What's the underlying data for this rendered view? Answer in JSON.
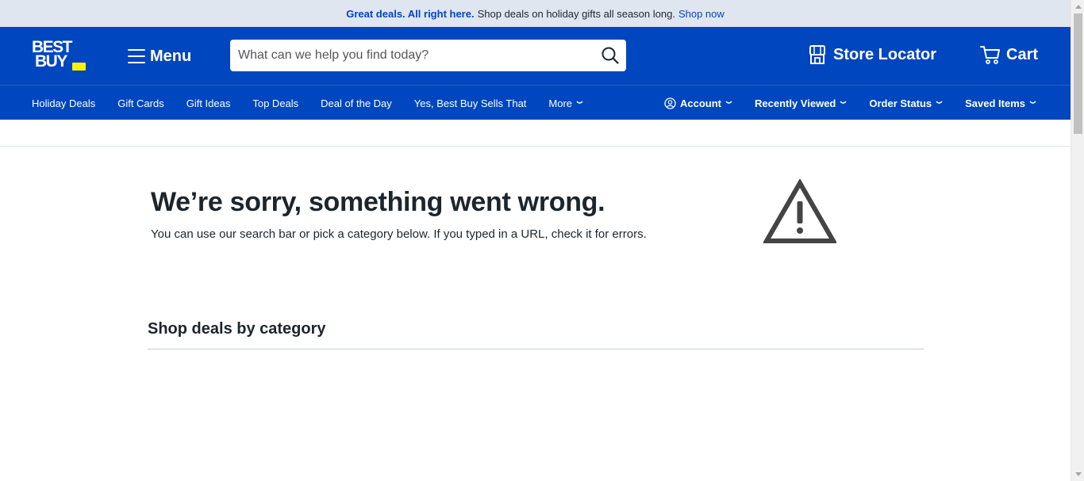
{
  "promo": {
    "bold": "Great deals. All right here.",
    "text": "Shop deals on holiday gifts all season long.",
    "link": "Shop now"
  },
  "header": {
    "logo_line1": "BEST",
    "logo_line2": "BUY",
    "menu_label": "Menu",
    "search_placeholder": "What can we help you find today?",
    "store_locator": "Store Locator",
    "cart": "Cart"
  },
  "nav": {
    "left": [
      "Holiday Deals",
      "Gift Cards",
      "Gift Ideas",
      "Top Deals",
      "Deal of the Day",
      "Yes, Best Buy Sells That",
      "More"
    ],
    "right": [
      "Account",
      "Recently Viewed",
      "Order Status",
      "Saved Items"
    ]
  },
  "error": {
    "title": "We’re sorry, something went wrong.",
    "subtitle": "You can use our search bar or pick a category below. If you typed in a URL, check it for errors."
  },
  "categories": {
    "title": "Shop deals by category"
  },
  "colors": {
    "brand_blue": "#0046be",
    "brand_yellow": "#fff200",
    "promo_bg": "#e0e6ef",
    "text_dark": "#1d252c"
  },
  "icons": [
    "hamburger-icon",
    "search-icon",
    "store-icon",
    "cart-icon",
    "account-icon",
    "chevron-down-icon",
    "warning-icon"
  ]
}
